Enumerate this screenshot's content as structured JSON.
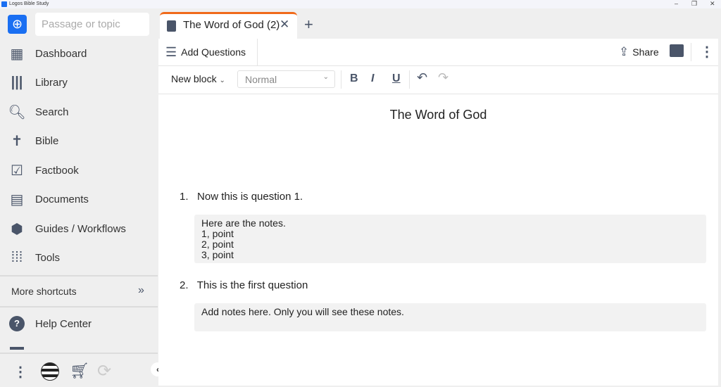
{
  "window": {
    "title": "Logos Bible Study",
    "minimize": "–",
    "restore": "❐",
    "close": "✕"
  },
  "sidebar": {
    "search_placeholder": "Passage or topic",
    "items": [
      {
        "label": "Dashboard"
      },
      {
        "label": "Library"
      },
      {
        "label": "Search"
      },
      {
        "label": "Bible"
      },
      {
        "label": "Factbook"
      },
      {
        "label": "Documents"
      },
      {
        "label": "Guides / Workflows"
      },
      {
        "label": "Tools"
      }
    ],
    "more_shortcuts": "More shortcuts",
    "help_center": "Help Center"
  },
  "tab": {
    "title": "The Word of God (2)"
  },
  "toolbar": {
    "add_questions": "Add Questions",
    "share": "Share"
  },
  "format": {
    "block": "New block",
    "style": "Normal",
    "bold": "B",
    "italic": "I",
    "underline": "U"
  },
  "document": {
    "title": "The Word of God",
    "questions": [
      {
        "number": "1.",
        "text": "Now this is question 1.",
        "notes": [
          "Here are the notes.",
          "1, point",
          "2, point",
          "3, point"
        ]
      },
      {
        "number": "2.",
        "text": "This is the first question",
        "notes": [
          "Add notes here. Only you will see these notes."
        ]
      }
    ]
  }
}
